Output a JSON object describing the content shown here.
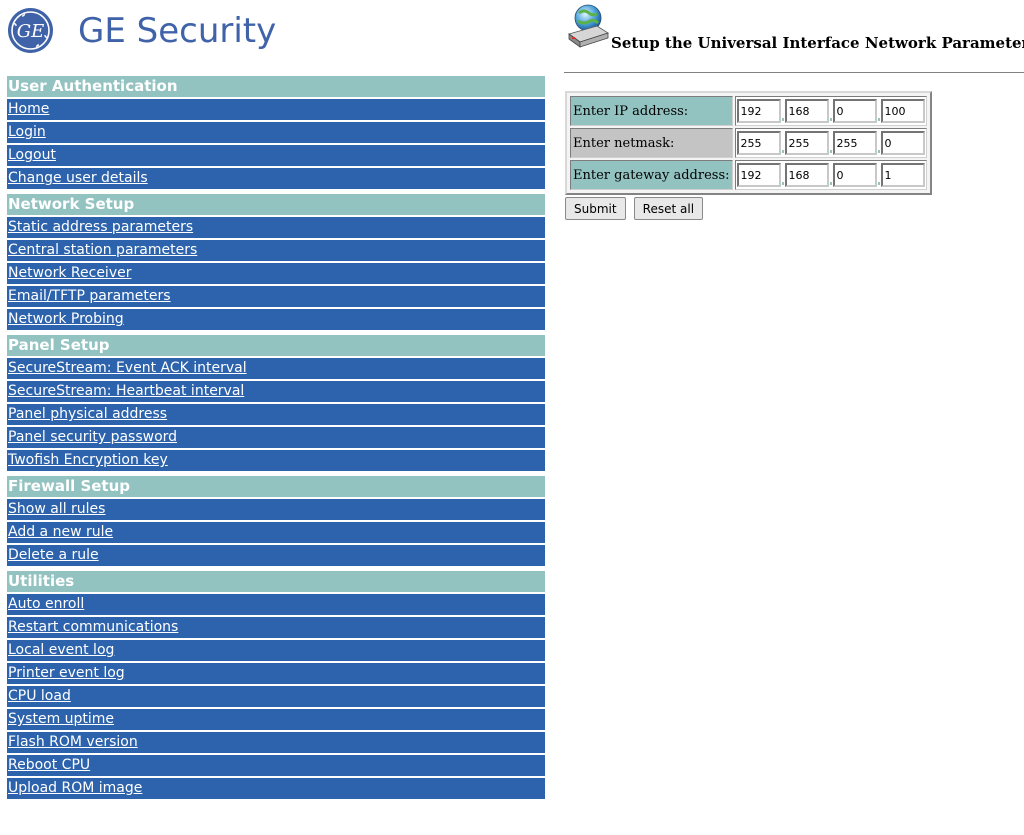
{
  "brand": {
    "name": "GE Security",
    "logo_text": "GE"
  },
  "page": {
    "title": "Setup the Universal Interface Network Parameters"
  },
  "sidebar": {
    "sections": [
      {
        "title": "User Authentication",
        "items": [
          "Home",
          "Login",
          "Logout",
          "Change user details"
        ]
      },
      {
        "title": "Network Setup",
        "items": [
          "Static address parameters",
          "Central station parameters",
          "Network Receiver",
          "Email/TFTP parameters",
          "Network Probing"
        ]
      },
      {
        "title": "Panel Setup",
        "items": [
          "SecureStream: Event ACK interval",
          "SecureStream: Heartbeat interval",
          "Panel physical address",
          "Panel security password",
          "Twofish Encryption key"
        ]
      },
      {
        "title": "Firewall Setup",
        "items": [
          "Show all rules",
          "Add a new rule",
          "Delete a rule"
        ]
      },
      {
        "title": "Utilities",
        "items": [
          "Auto enroll",
          "Restart communications",
          "Local event log",
          "Printer event log",
          "CPU load",
          "System uptime",
          "Flash ROM version",
          "Reboot CPU",
          "Upload ROM image"
        ]
      }
    ]
  },
  "form": {
    "rows": [
      {
        "label": "Enter IP address:",
        "octets": [
          "192",
          "168",
          "0",
          "100"
        ]
      },
      {
        "label": "Enter netmask:",
        "octets": [
          "255",
          "255",
          "255",
          "0"
        ]
      },
      {
        "label": "Enter gateway address:",
        "octets": [
          "192",
          "168",
          "0",
          "1"
        ]
      }
    ],
    "submit_label": "Submit",
    "reset_label": "Reset all"
  },
  "colors": {
    "nav_blue": "#2c63ac",
    "section_teal": "#93c3c1",
    "brand_blue": "#3f62a8"
  },
  "icons": {
    "logo": "ge-monogram-icon",
    "header": "network-router-globe-icon"
  }
}
